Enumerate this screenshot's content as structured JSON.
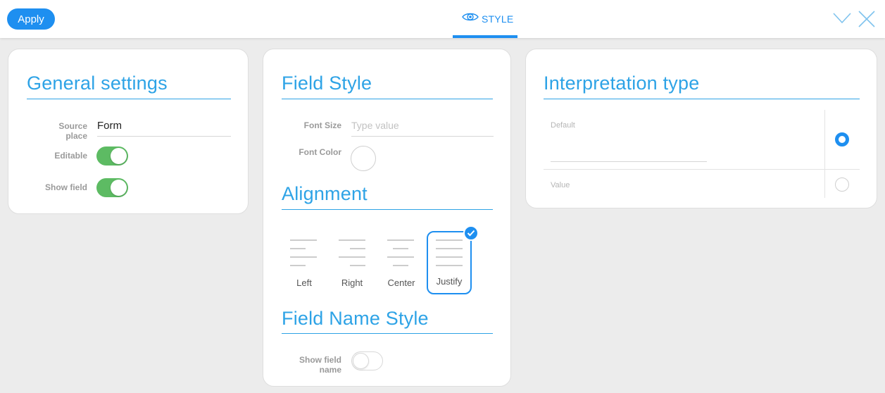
{
  "toolbar": {
    "apply_label": "Apply",
    "active_tab_label": "STYLE",
    "tab_icon": "eye-icon",
    "accent_color": "#1e8ff0"
  },
  "general_settings": {
    "title": "General settings",
    "source_place_label_line1": "Source",
    "source_place_label_line2": "place",
    "source_place_value": "Form",
    "editable_label": "Editable",
    "editable_on": true,
    "show_field_label": "Show field",
    "show_field_on": true,
    "toggle_on_color": "#5dbb63"
  },
  "field_style": {
    "title": "Field Style",
    "font_size_label": "Font Size",
    "font_size_placeholder": "Type value",
    "font_color_label": "Font Color",
    "alignment_title": "Alignment",
    "alignment_options": [
      {
        "label": "Left",
        "selected": false
      },
      {
        "label": "Right",
        "selected": false
      },
      {
        "label": "Center",
        "selected": false
      },
      {
        "label": "Justify",
        "selected": true
      }
    ],
    "field_name_style_title": "Field Name Style",
    "show_field_name_label_line1": "Show field",
    "show_field_name_label_line2": "name",
    "show_field_name_on": false
  },
  "interpretation": {
    "title": "Interpretation type",
    "options": [
      {
        "label": "Default",
        "checked": true
      },
      {
        "label": "Value",
        "checked": false
      }
    ]
  },
  "title_color": "#2ea3e6"
}
